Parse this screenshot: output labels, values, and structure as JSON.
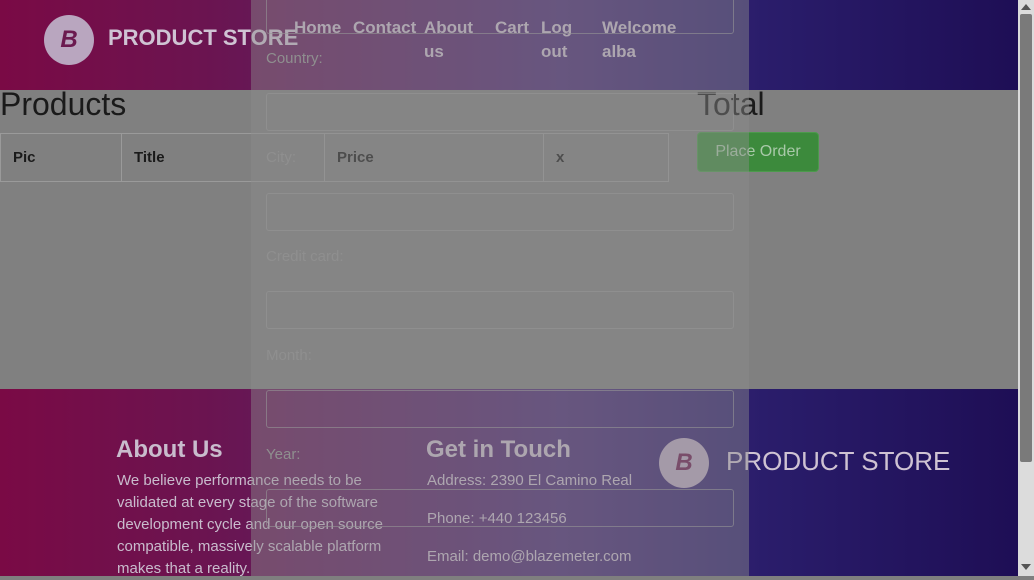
{
  "navbar": {
    "brand": "PRODUCT STORE",
    "logo_letter": "B",
    "links": [
      "Home",
      "Contact",
      "About us",
      "Cart",
      "Log out",
      "Welcome alba"
    ]
  },
  "products_title": "Products",
  "total_title": "Total",
  "table_headers": [
    "Pic",
    "Title",
    "Price",
    "x"
  ],
  "place_order_label": "Place Order",
  "modal": {
    "labels": [
      "Country:",
      "City:",
      "Credit card:",
      "Month:",
      "Year:"
    ]
  },
  "footer": {
    "about_heading": "About Us",
    "about_lines": [
      "We believe performance needs to be",
      "validated at every stage of the software",
      "development cycle and our open source",
      "compatible, massively scalable platform",
      "makes that a reality."
    ],
    "contact_heading": "Get in Touch",
    "address": "Address: 2390 El Camino Real",
    "phone": "Phone: +440 123456",
    "email": "Email: demo@blazemeter.com",
    "brand": "PRODUCT STORE",
    "logo_letter": "B"
  },
  "icons": {
    "logo": "blazemeter-logo-icon",
    "scroll_up": "chevron-up-icon",
    "scroll_down": "chevron-down-icon"
  }
}
